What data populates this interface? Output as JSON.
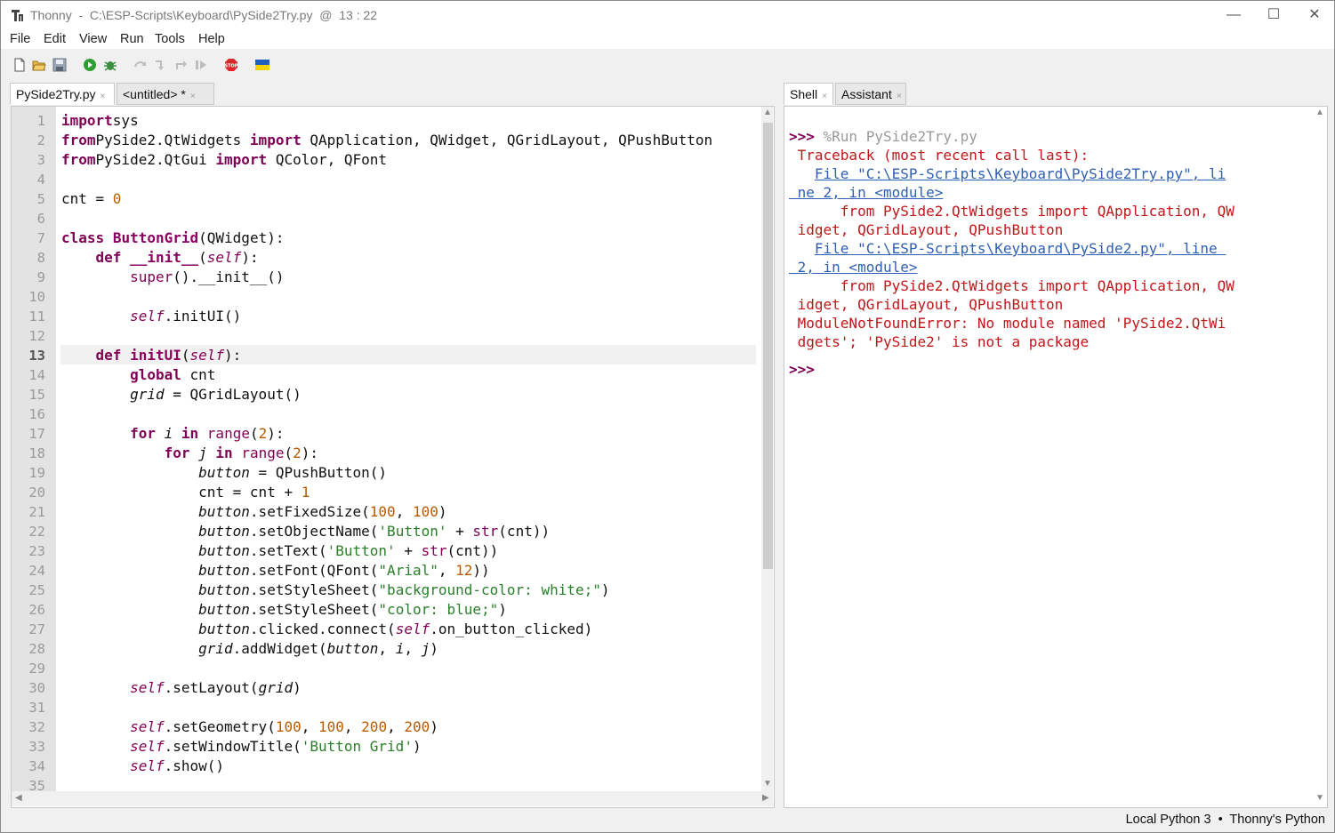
{
  "window": {
    "app_name": "Thonny",
    "title_rest": "  -  C:\\ESP-Scripts\\Keyboard\\PySide2Try.py  @  13 : 22",
    "minimize": "—",
    "maximize": "☐",
    "close": "✕"
  },
  "menu": [
    "File",
    "Edit",
    "View",
    "Run",
    "Tools",
    "Help"
  ],
  "toolbar_icons": [
    "new-file-icon",
    "open-file-icon",
    "save-icon",
    "run-icon",
    "debug-icon",
    "step-over-icon",
    "step-into-icon",
    "step-out-icon",
    "resume-icon",
    "stop-icon",
    "ukraine-flag-icon"
  ],
  "editor": {
    "tabs": [
      {
        "label": "PySide2Try.py",
        "close": "×"
      },
      {
        "label": "<untitled> *",
        "close": "×"
      }
    ],
    "line_numbers": [
      "1",
      "2",
      "3",
      "4",
      "5",
      "6",
      "7",
      "8",
      "9",
      "10",
      "11",
      "12",
      "13",
      "14",
      "15",
      "16",
      "17",
      "18",
      "19",
      "20",
      "21",
      "22",
      "23",
      "24",
      "25",
      "26",
      "27",
      "28",
      "29",
      "30",
      "31",
      "32",
      "33",
      "34",
      "35"
    ],
    "current_line": "13",
    "lines": [
      [
        [
          "kw",
          "import"
        ],
        [
          "",
          "sys"
        ]
      ],
      [
        [
          "kw",
          "from"
        ],
        [
          "",
          "PySide2.QtWidgets "
        ],
        [
          "kw",
          "import"
        ],
        [
          "",
          " QApplication, QWidget, QGridLayout, QPushButton"
        ]
      ],
      [
        [
          "kw",
          "from"
        ],
        [
          "",
          "PySide2.QtGui "
        ],
        [
          "kw",
          "import"
        ],
        [
          "",
          " QColor, QFont"
        ]
      ],
      [],
      [
        [
          "",
          "cnt = "
        ],
        [
          "num",
          "0"
        ]
      ],
      [],
      [
        [
          "kw",
          "class"
        ],
        [
          "",
          " "
        ],
        [
          "nm",
          "ButtonGrid"
        ],
        [
          "",
          "(QWidget):"
        ]
      ],
      [
        [
          "",
          "    "
        ],
        [
          "kw",
          "def"
        ],
        [
          "",
          " "
        ],
        [
          "nm",
          "__init__"
        ],
        [
          "",
          "("
        ],
        [
          "self",
          "self"
        ],
        [
          "",
          "):"
        ]
      ],
      [
        [
          "",
          "        "
        ],
        [
          "bi",
          "super"
        ],
        [
          "",
          "().__init__()"
        ]
      ],
      [],
      [
        [
          "",
          "        "
        ],
        [
          "self",
          "self"
        ],
        [
          "",
          ".initUI()"
        ]
      ],
      [],
      [
        [
          "",
          "    "
        ],
        [
          "kw",
          "def"
        ],
        [
          "",
          " "
        ],
        [
          "nm",
          "initUI"
        ],
        [
          "",
          "("
        ],
        [
          "self",
          "self"
        ],
        [
          "",
          "):"
        ]
      ],
      [
        [
          "",
          "        "
        ],
        [
          "kw",
          "global"
        ],
        [
          "",
          " cnt"
        ]
      ],
      [
        [
          "",
          "        "
        ],
        [
          "it",
          "grid"
        ],
        [
          "",
          " = QGridLayout()"
        ]
      ],
      [],
      [
        [
          "",
          "        "
        ],
        [
          "kw",
          "for"
        ],
        [
          "",
          " "
        ],
        [
          "it",
          "i"
        ],
        [
          "",
          " "
        ],
        [
          "kw",
          "in"
        ],
        [
          "",
          " "
        ],
        [
          "bi",
          "range"
        ],
        [
          "",
          "("
        ],
        [
          "num",
          "2"
        ],
        [
          "",
          "):"
        ]
      ],
      [
        [
          "",
          "            "
        ],
        [
          "kw",
          "for"
        ],
        [
          "",
          " "
        ],
        [
          "it",
          "j"
        ],
        [
          "",
          " "
        ],
        [
          "kw",
          "in"
        ],
        [
          "",
          " "
        ],
        [
          "bi",
          "range"
        ],
        [
          "",
          "("
        ],
        [
          "num",
          "2"
        ],
        [
          "",
          "):"
        ]
      ],
      [
        [
          "",
          "                "
        ],
        [
          "it",
          "button"
        ],
        [
          "",
          " = QPushButton()"
        ]
      ],
      [
        [
          "",
          "                cnt = cnt + "
        ],
        [
          "num",
          "1"
        ]
      ],
      [
        [
          "",
          "                "
        ],
        [
          "it",
          "button"
        ],
        [
          "",
          ".setFixedSize("
        ],
        [
          "num",
          "100"
        ],
        [
          "",
          ", "
        ],
        [
          "num",
          "100"
        ],
        [
          "",
          ")"
        ]
      ],
      [
        [
          "",
          "                "
        ],
        [
          "it",
          "button"
        ],
        [
          "",
          ".setObjectName("
        ],
        [
          "str",
          "'Button'"
        ],
        [
          "",
          " + "
        ],
        [
          "bi",
          "str"
        ],
        [
          "",
          "(cnt))"
        ]
      ],
      [
        [
          "",
          "                "
        ],
        [
          "it",
          "button"
        ],
        [
          "",
          ".setText("
        ],
        [
          "str",
          "'Button'"
        ],
        [
          "",
          " + "
        ],
        [
          "bi",
          "str"
        ],
        [
          "",
          "(cnt))"
        ]
      ],
      [
        [
          "",
          "                "
        ],
        [
          "it",
          "button"
        ],
        [
          "",
          ".setFont(QFont("
        ],
        [
          "str",
          "\"Arial\""
        ],
        [
          "",
          ", "
        ],
        [
          "num",
          "12"
        ],
        [
          "",
          "))"
        ]
      ],
      [
        [
          "",
          "                "
        ],
        [
          "it",
          "button"
        ],
        [
          "",
          ".setStyleSheet("
        ],
        [
          "str",
          "\"background-color: white;\""
        ],
        [
          "",
          ")"
        ]
      ],
      [
        [
          "",
          "                "
        ],
        [
          "it",
          "button"
        ],
        [
          "",
          ".setStyleSheet("
        ],
        [
          "str",
          "\"color: blue;\""
        ],
        [
          "",
          ")"
        ]
      ],
      [
        [
          "",
          "                "
        ],
        [
          "it",
          "button"
        ],
        [
          "",
          ".clicked.connect("
        ],
        [
          "self",
          "self"
        ],
        [
          "",
          ".on_button_clicked)"
        ]
      ],
      [
        [
          "",
          "                "
        ],
        [
          "it",
          "grid"
        ],
        [
          "",
          ".addWidget("
        ],
        [
          "it",
          "button"
        ],
        [
          "",
          ", "
        ],
        [
          "it",
          "i"
        ],
        [
          "",
          ", "
        ],
        [
          "it",
          "j"
        ],
        [
          "",
          ")"
        ]
      ],
      [],
      [
        [
          "",
          "        "
        ],
        [
          "self",
          "self"
        ],
        [
          "",
          ".setLayout("
        ],
        [
          "it",
          "grid"
        ],
        [
          "",
          ")"
        ]
      ],
      [],
      [
        [
          "",
          "        "
        ],
        [
          "self",
          "self"
        ],
        [
          "",
          ".setGeometry("
        ],
        [
          "num",
          "100"
        ],
        [
          "",
          ", "
        ],
        [
          "num",
          "100"
        ],
        [
          "",
          ", "
        ],
        [
          "num",
          "200"
        ],
        [
          "",
          ", "
        ],
        [
          "num",
          "200"
        ],
        [
          "",
          ")"
        ]
      ],
      [
        [
          "",
          "        "
        ],
        [
          "self",
          "self"
        ],
        [
          "",
          ".setWindowTitle("
        ],
        [
          "str",
          "'Button Grid'"
        ],
        [
          "",
          ")"
        ]
      ],
      [
        [
          "",
          "        "
        ],
        [
          "self",
          "self"
        ],
        [
          "",
          ".show()"
        ]
      ]
    ]
  },
  "shell": {
    "tabs": [
      {
        "label": "Shell",
        "close": "×"
      },
      {
        "label": "Assistant",
        "close": "×"
      }
    ],
    "lines": [
      [
        [
          "prompt",
          ">>> "
        ],
        [
          "muted",
          "%Run PySide2Try.py"
        ]
      ],
      [
        [
          "err",
          " Traceback (most recent call last):"
        ]
      ],
      [
        [
          "err",
          "   "
        ],
        [
          "link",
          "File \"C:\\ESP-Scripts\\Keyboard\\PySide2Try.py\", li"
        ]
      ],
      [
        [
          "link",
          " ne 2, in <module>"
        ]
      ],
      [
        [
          "err",
          "      from PySide2.QtWidgets import QApplication, QW"
        ]
      ],
      [
        [
          "err",
          " idget, QGridLayout, QPushButton"
        ]
      ],
      [
        [
          "err",
          "   "
        ],
        [
          "link",
          "File \"C:\\ESP-Scripts\\Keyboard\\PySide2.py\", line "
        ]
      ],
      [
        [
          "link",
          " 2, in <module>"
        ]
      ],
      [
        [
          "err",
          "      from PySide2.QtWidgets import QApplication, QW"
        ]
      ],
      [
        [
          "err",
          " idget, QGridLayout, QPushButton"
        ]
      ],
      [
        [
          "err",
          " ModuleNotFoundError: No module named 'PySide2.QtWi"
        ]
      ],
      [
        [
          "err",
          " dgets'; 'PySide2' is not a package"
        ]
      ],
      [
        [
          "prompt",
          ">>>"
        ]
      ]
    ]
  },
  "status": "Local Python 3  •  Thonny's Python"
}
